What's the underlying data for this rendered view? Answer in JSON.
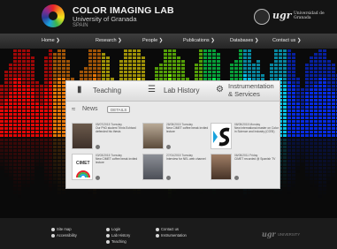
{
  "header": {
    "title": "COLOR IMAGING LAB",
    "subtitle": "University of Granada",
    "country": "SPAIN",
    "university_logo": "ugr",
    "university_sub": "Universidad de Granada"
  },
  "nav": [
    {
      "label": "Home",
      "icon": "chevron-right-icon"
    },
    {
      "label": "Research",
      "icon": "chevron-right-icon"
    },
    {
      "label": "People",
      "icon": "chevron-right-icon"
    },
    {
      "label": "Publications",
      "icon": "chevron-right-icon"
    },
    {
      "label": "Databases",
      "icon": "chevron-right-icon"
    },
    {
      "label": "Contact us",
      "icon": "chevron-right-icon"
    }
  ],
  "tabs": [
    {
      "label": "Teaching",
      "icon": "book-icon"
    },
    {
      "label": "Lab History",
      "icon": "history-icon"
    },
    {
      "label": "Instrumentation & Services",
      "icon": "gear-icon"
    }
  ],
  "news": {
    "title": "News",
    "more_label": "DETAILS",
    "items": [
      {
        "date": "05/07/2015 Tuesday",
        "text": "Our PhD student Trinis Echtard defended his thesis"
      },
      {
        "date": "28/05/2015 Tuesday",
        "text": "New CIMET coffee break invited lecture"
      },
      {
        "date": "08/05/2015 Monday",
        "text": "New international master on Color in Science and Industry (COSI)"
      },
      {
        "date": "03/03/2015 Tuesday",
        "text": "New CIMET coffee break invited lecture"
      },
      {
        "date": "27/01/2015 Tuesday",
        "text": "Interview for NEL web channel"
      },
      {
        "date": "06/05/2011 Friday",
        "text": "CIMET recorded @ Spanish TV"
      }
    ]
  },
  "footer": {
    "links": [
      "Site map",
      "Accessibility",
      "Login",
      "Lab History",
      "Teaching",
      "Contact us",
      "Instrumentation"
    ],
    "logo": "ugr",
    "logo_sub": "UNIVERSITY"
  },
  "colors": {
    "nav_bg": "#2f2f2f",
    "panel_bg": "#e9e9e9",
    "footer_bg": "#1b1b1b"
  }
}
